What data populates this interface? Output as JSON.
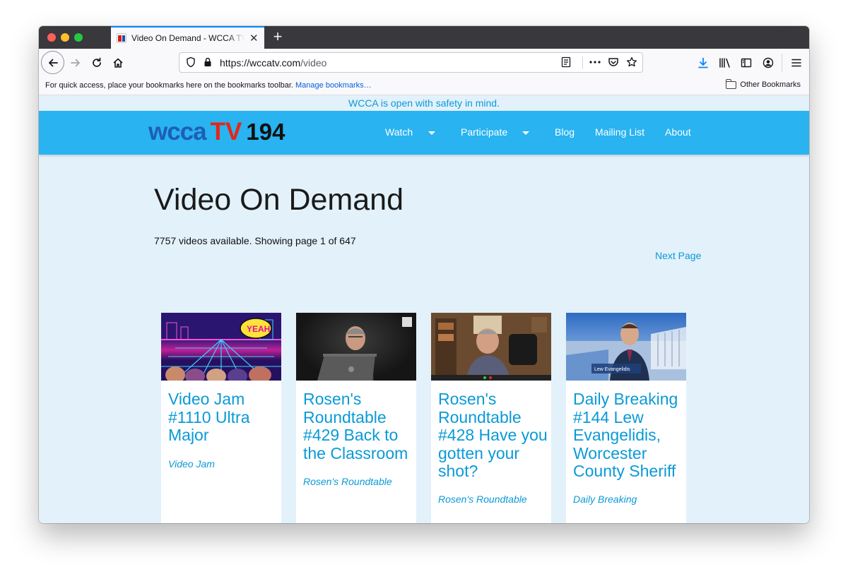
{
  "browser": {
    "tab_title": "Video On Demand - WCCA TV 194",
    "url_host": "https://wccatv.com",
    "url_path": "/video",
    "bookmarks_prompt": "For quick access, place your bookmarks here on the bookmarks toolbar.",
    "manage_bookmarks": "Manage bookmarks…",
    "other_bookmarks": "Other Bookmarks"
  },
  "site": {
    "notice": "WCCA is open with safety in mind.",
    "logo": {
      "wcca": "wcca",
      "tv": "TV",
      "num": "194"
    },
    "menu": {
      "watch": "Watch",
      "participate": "Participate",
      "blog": "Blog",
      "mailing_list": "Mailing List",
      "about": "About"
    }
  },
  "main": {
    "title": "Video On Demand",
    "count_text": "7757 videos available. Showing page 1 of 647",
    "next_page": "Next Page",
    "videos": [
      {
        "title": "Video Jam #1110 Ultra Major",
        "show": "Video Jam",
        "thumb_text": "YEAH"
      },
      {
        "title": "Rosen's Roundtable #429 Back to the Classroom",
        "show": "Rosen's Roundtable"
      },
      {
        "title": "Rosen's Roundtable #428 Have you gotten your shot?",
        "show": "Rosen's Roundtable"
      },
      {
        "title": "Daily Breaking #144 Lew Evangelidis, Worcester County Sheriff",
        "show": "Daily Breaking",
        "thumb_caption": "Lew Evangelidis"
      }
    ]
  },
  "colors": {
    "nav_blue": "#29b3f0",
    "page_bg": "#e3f1fb",
    "link_blue": "#0a9ad7",
    "logo_blue": "#1d5eb8",
    "logo_red": "#e32619"
  }
}
